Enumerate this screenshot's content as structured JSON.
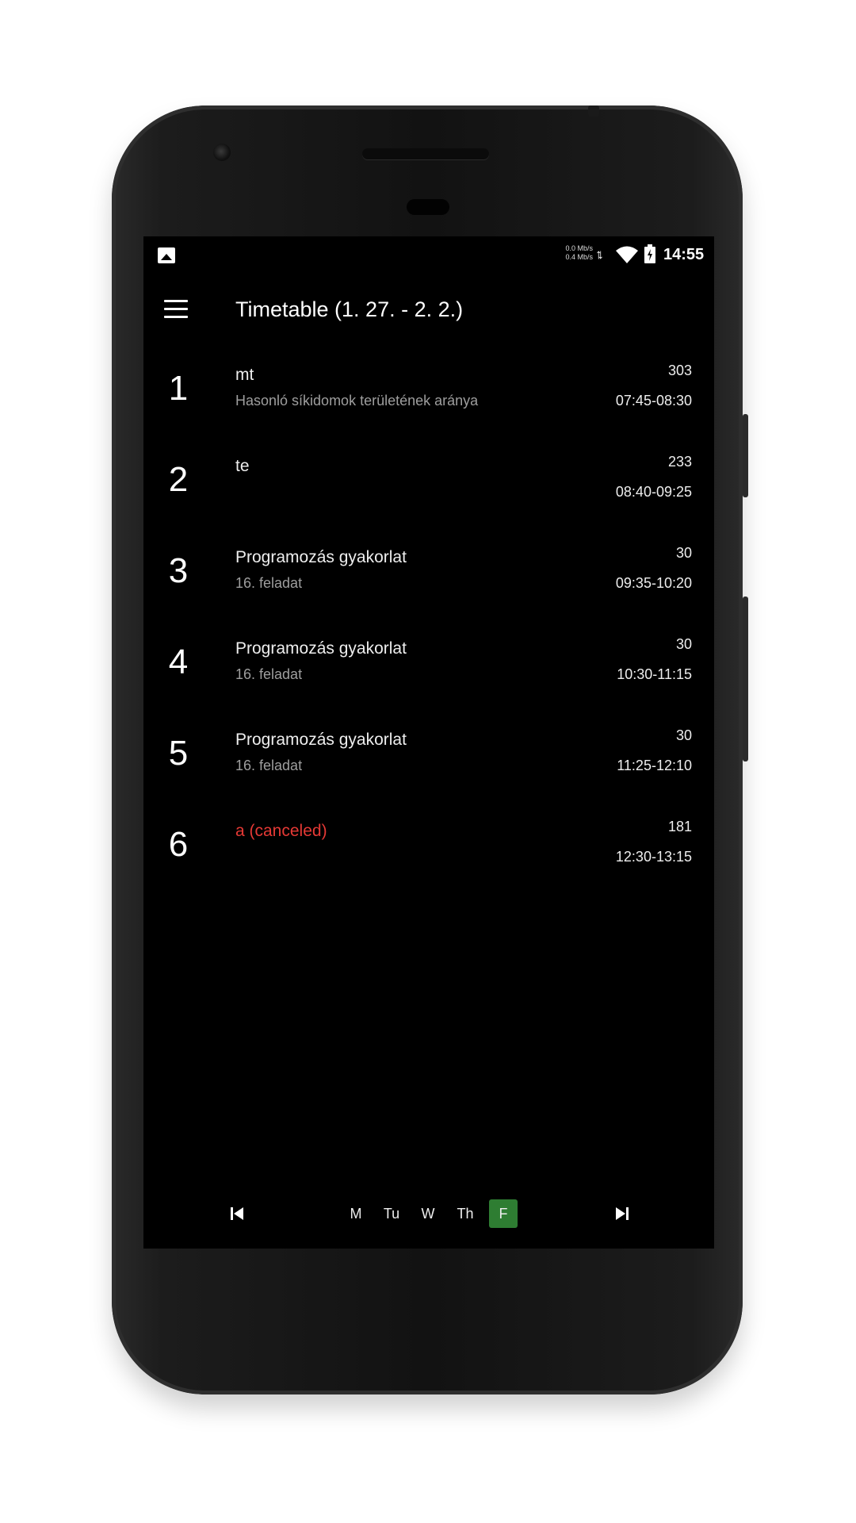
{
  "status_bar": {
    "net_speed_up": "0.0 Mb/s",
    "net_speed_down": "0.4 Mb/s",
    "time": "14:55",
    "icons": [
      "image-icon",
      "data-arrows-icon",
      "wifi-icon",
      "battery-charging-icon"
    ]
  },
  "app_bar": {
    "title": "Timetable (1. 27. - 2. 2.)",
    "menu_icon": "hamburger-menu-icon"
  },
  "lessons": [
    {
      "number": "1",
      "subject": "mt",
      "topic": "Hasonló síkidomok területének aránya",
      "room": "303",
      "time": "07:45-08:30",
      "canceled": false
    },
    {
      "number": "2",
      "subject": "te",
      "topic": "",
      "room": "233",
      "time": "08:40-09:25",
      "canceled": false
    },
    {
      "number": "3",
      "subject": "Programozás gyakorlat",
      "topic": "16. feladat",
      "room": "30",
      "time": "09:35-10:20",
      "canceled": false
    },
    {
      "number": "4",
      "subject": "Programozás gyakorlat",
      "topic": "16. feladat",
      "room": "30",
      "time": "10:30-11:15",
      "canceled": false
    },
    {
      "number": "5",
      "subject": "Programozás gyakorlat",
      "topic": "16. feladat",
      "room": "30",
      "time": "11:25-12:10",
      "canceled": false
    },
    {
      "number": "6",
      "subject": "a (canceled)",
      "topic": "",
      "room": "181",
      "time": "12:30-13:15",
      "canceled": true
    }
  ],
  "week_nav": {
    "prev_icon": "skip-previous-icon",
    "next_icon": "skip-next-icon",
    "days": [
      "M",
      "Tu",
      "W",
      "Th",
      "F"
    ],
    "selected_day": "F"
  },
  "colors": {
    "background": "#000000",
    "text": "#eeeeee",
    "secondary_text": "#9e9e9e",
    "canceled": "#e53935",
    "selected_day": "#2e7d32"
  }
}
